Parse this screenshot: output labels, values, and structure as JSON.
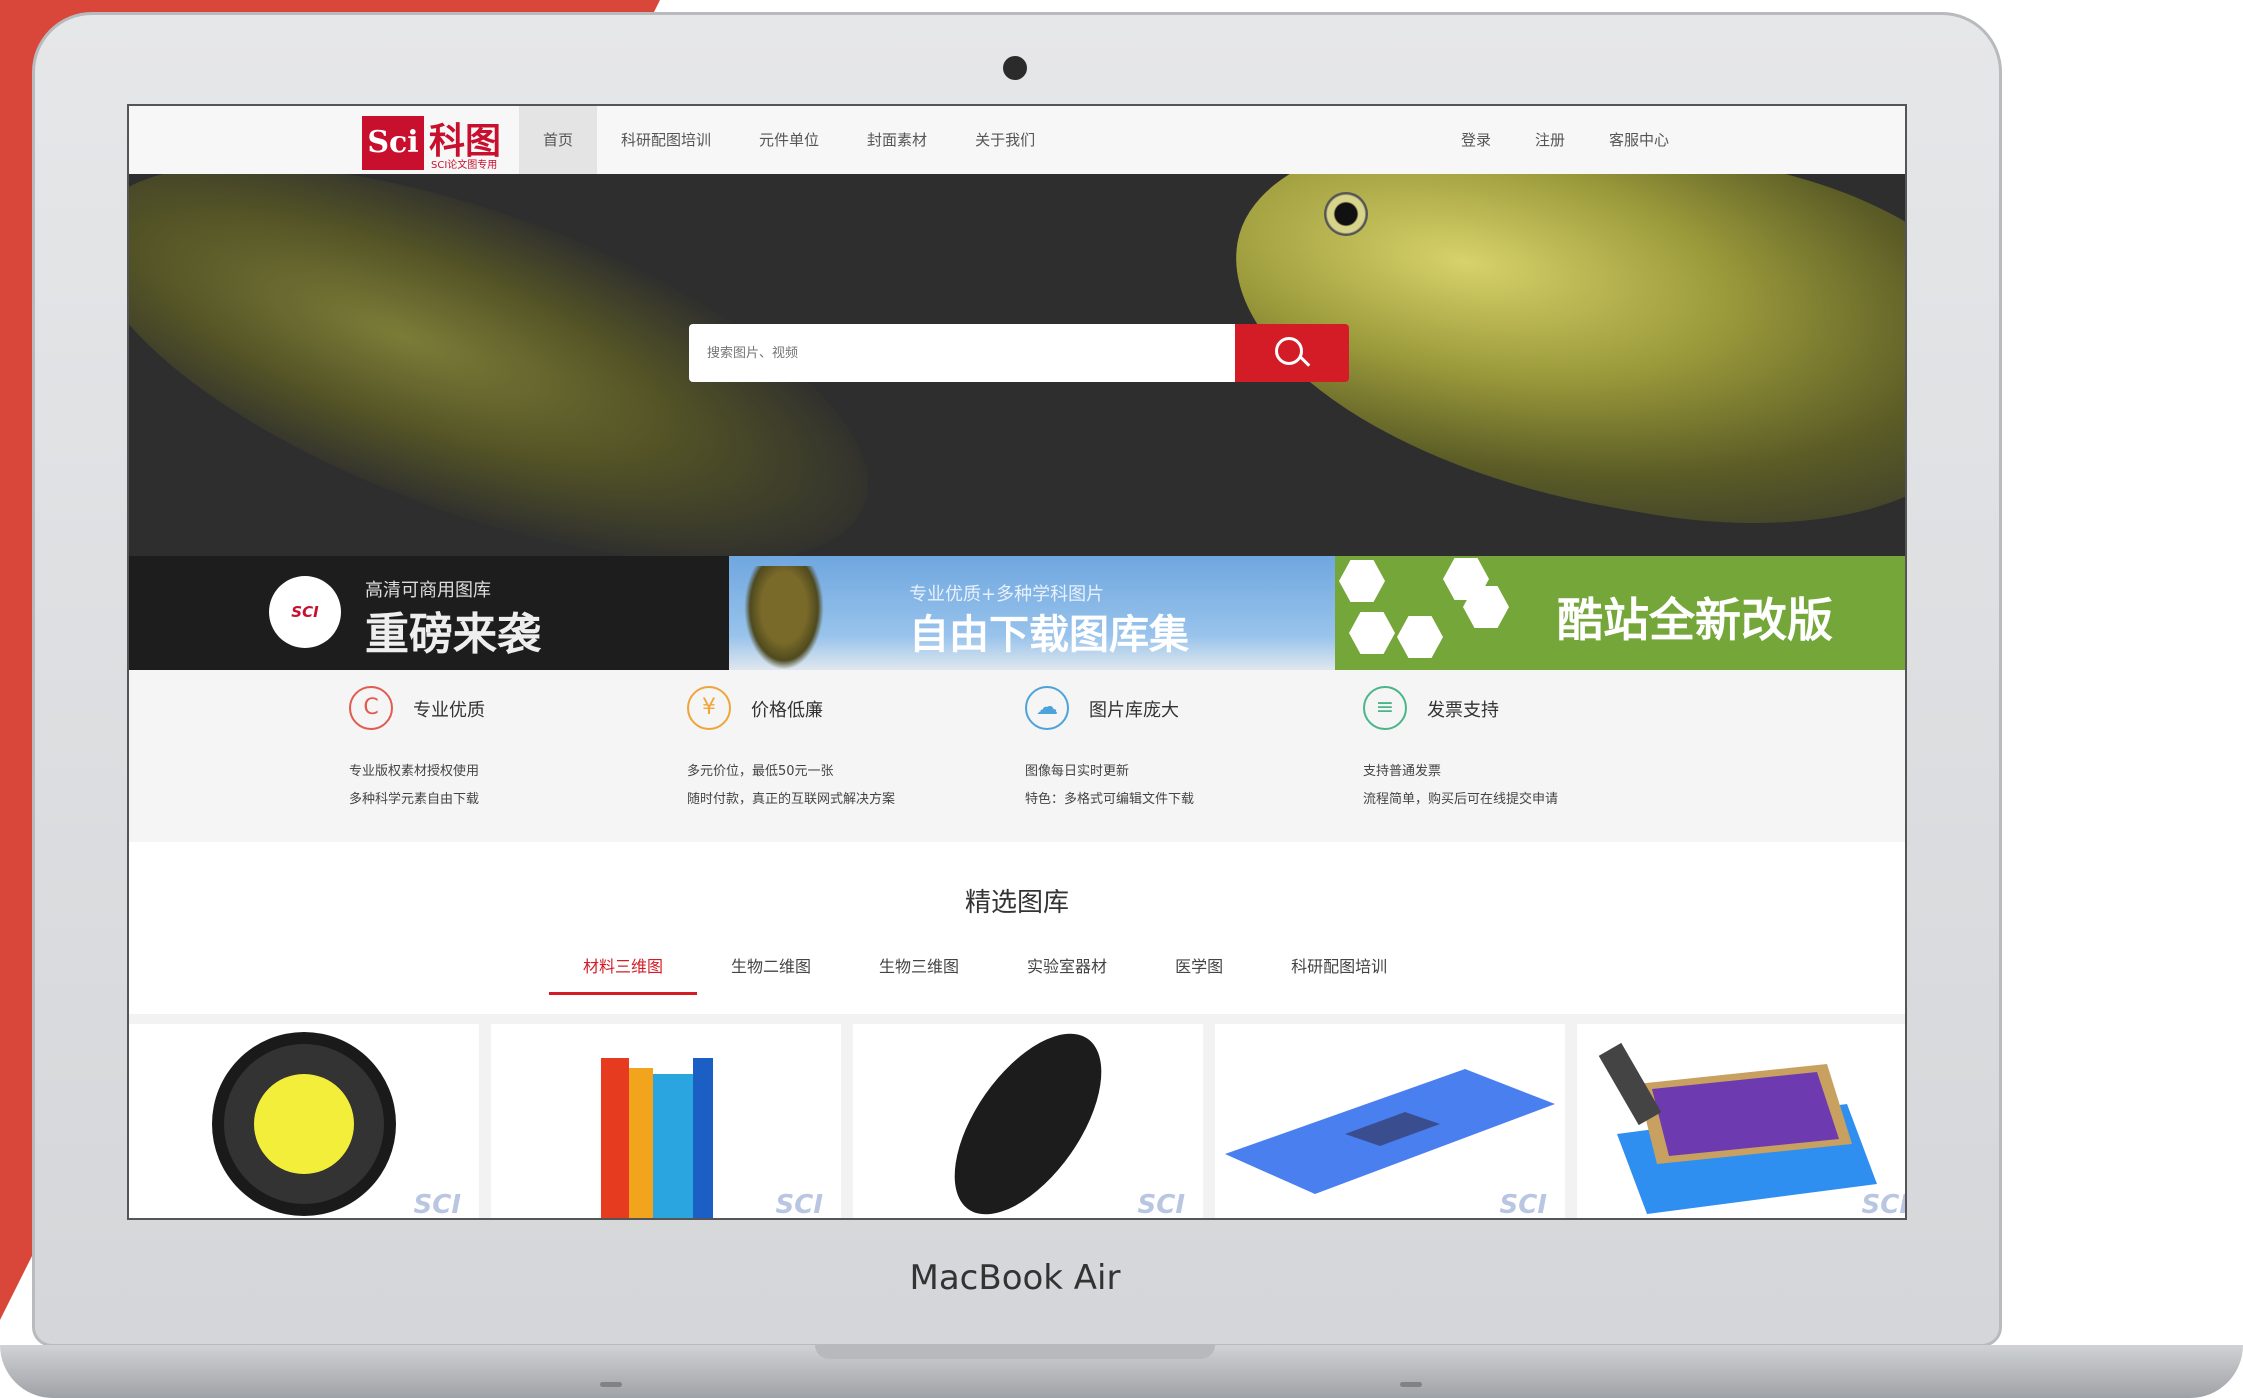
{
  "laptop": {
    "brand": "MacBook Air"
  },
  "header": {
    "logo_mark": "Sci",
    "logo_text": "科图",
    "logo_sub": "SCI论文图专用",
    "nav": [
      "首页",
      "科研配图培训",
      "元件单位",
      "封面素材",
      "关于我们"
    ],
    "nav_active": "首页",
    "right": [
      "登录",
      "注册",
      "客服中心"
    ]
  },
  "search": {
    "placeholder": "搜索图片、视频",
    "button_icon": "search-icon"
  },
  "banners": [
    {
      "badge": "SCI",
      "small": "高清可商用图库",
      "big": "重磅来袭",
      "bg": "#1d1d1d"
    },
    {
      "small": "专业优质+多种学科图片",
      "big": "自由下载图库集",
      "bg": "#6fa7df"
    },
    {
      "big": "酷站全新改版",
      "bg": "#74a63a"
    }
  ],
  "features": [
    {
      "icon": "copyright-icon",
      "glyph": "C",
      "color": "#e15b50",
      "title": "专业优质",
      "lines": [
        "专业版权素材授权使用",
        "多种科学元素自由下载"
      ]
    },
    {
      "icon": "yen-icon",
      "glyph": "¥",
      "color": "#f0a43a",
      "title": "价格低廉",
      "lines": [
        "多元价位，最低50元一张",
        "随时付款，真正的互联网式解决方案"
      ]
    },
    {
      "icon": "cloud-icon",
      "glyph": "☁",
      "color": "#4ca3d9",
      "title": "图片库庞大",
      "lines": [
        "图像每日实时更新",
        "特色：多格式可编辑文件下载"
      ]
    },
    {
      "icon": "invoice-icon",
      "glyph": "≡",
      "color": "#4bb58a",
      "title": "发票支持",
      "lines": [
        "支持普通发票",
        "流程简单，购买后可在线提交申请"
      ]
    }
  ],
  "gallery": {
    "title": "精选图库",
    "tabs": [
      "材料三维图",
      "生物二维图",
      "生物三维图",
      "实验室器材",
      "医学图",
      "科研配图培训"
    ],
    "active_tab": "材料三维图",
    "watermark": "SCI"
  },
  "colors": {
    "accent": "#d41c27",
    "brand": "#c8102e",
    "backdrop": "#d9473a"
  }
}
